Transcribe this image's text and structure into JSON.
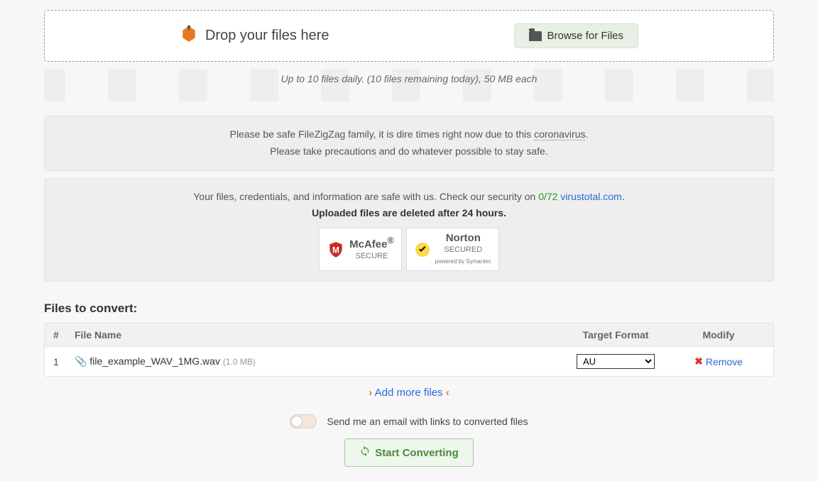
{
  "dropzone": {
    "drop_label": "Drop your files here",
    "browse_label": "Browse for Files"
  },
  "limit_text": "Up to 10 files daily. (10 files remaining today), 50 MB each",
  "notice": {
    "line1_prefix": "Please be safe FileZigZag family, it is dire times right now due to this ",
    "coronavirus_link": "coronavirus",
    "line1_suffix": ".",
    "line2": "Please take precautions and do whatever possible to stay safe."
  },
  "security": {
    "line1_prefix": "Your files, credentials, and information are safe with us. Check our security on ",
    "ratio": "0/72",
    "virustotal": "virustotal.com",
    "line1_suffix": ".",
    "line2_bold": "Uploaded files are deleted after 24 hours.",
    "badges": {
      "mcafee_brand": "McAfee",
      "mcafee_sub": "SECURE",
      "norton_brand": "Norton",
      "norton_sub": "SECURED",
      "norton_powered": "powered by Symantec"
    }
  },
  "files_section": {
    "title": "Files to convert:",
    "headers": {
      "num": "#",
      "name": "File Name",
      "format": "Target Format",
      "modify": "Modify"
    },
    "rows": [
      {
        "num": "1",
        "name": "file_example_WAV_1MG.wav",
        "size": "(1.0 MB)",
        "format": "AU",
        "remove": "Remove"
      }
    ],
    "add_more": "Add more files"
  },
  "email": {
    "label": "Send me an email with links to converted files"
  },
  "start_button": "Start Converting"
}
